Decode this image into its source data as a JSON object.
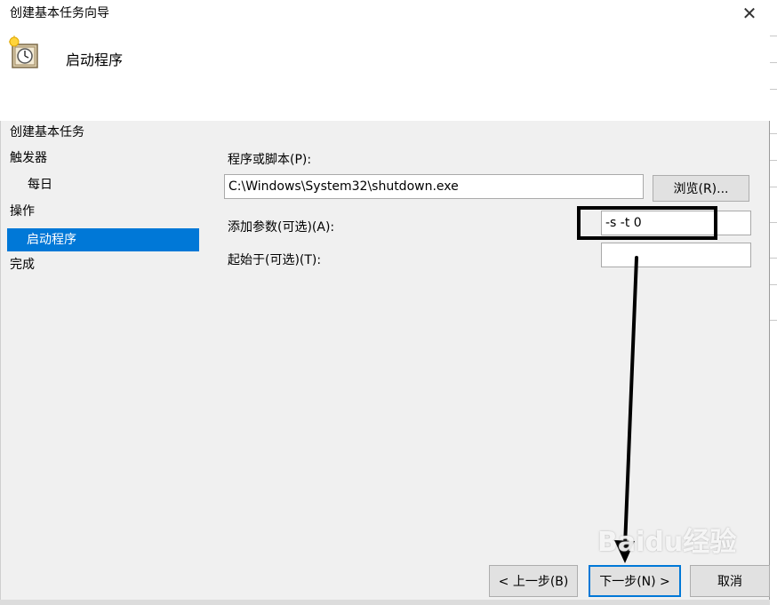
{
  "window": {
    "title": "创建基本任务向导",
    "close_glyph": "✕"
  },
  "header": {
    "title": "启动程序",
    "icon": "task-clock-icon"
  },
  "nav": {
    "items": [
      {
        "label": "创建基本任务"
      },
      {
        "label": "触发器"
      },
      {
        "label": "每日"
      },
      {
        "label": "操作"
      },
      {
        "label": "启动程序"
      },
      {
        "label": "完成"
      }
    ],
    "selected_index": 4
  },
  "form": {
    "program_label": "程序或脚本(P):",
    "program_value": "C:\\Windows\\System32\\shutdown.exe",
    "browse_label": "浏览(R)...",
    "args_label": "添加参数(可选)(A):",
    "args_value": "-s -t 0",
    "start_in_label": "起始于(可选)(T):",
    "start_in_value": ""
  },
  "footer": {
    "back_label": "< 上一步(B)",
    "next_label": "下一步(N) >",
    "cancel_label": "取消"
  },
  "watermark": {
    "text": "Baidu经验"
  },
  "colors": {
    "selection": "#0078d7",
    "annotation": "#000000"
  }
}
